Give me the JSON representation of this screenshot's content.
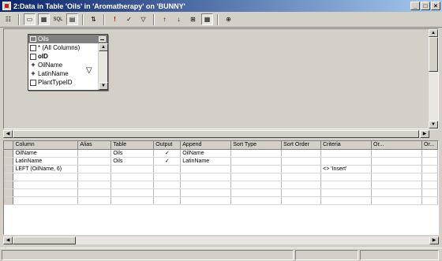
{
  "window": {
    "title": "2:Data in Table 'Oils' in 'Aromatherapy' on 'BUNNY'",
    "minimize": "_",
    "maximize": "□",
    "close": "×"
  },
  "toolbar": {
    "buttons": [
      {
        "name": "properties",
        "glyph": "☷"
      },
      {
        "name": "diagram-pane",
        "glyph": "▭"
      },
      {
        "name": "grid-pane",
        "glyph": "▦"
      },
      {
        "name": "sql-pane",
        "glyph": "SQL"
      },
      {
        "name": "results-pane",
        "glyph": "▤"
      },
      {
        "name": "change-query-type",
        "glyph": "⇅"
      },
      {
        "name": "run",
        "glyph": "!"
      },
      {
        "name": "verify-sql",
        "glyph": "✓"
      },
      {
        "name": "remove-filter",
        "glyph": "▽"
      },
      {
        "name": "sort-ascending",
        "glyph": "↑"
      },
      {
        "name": "sort-descending",
        "glyph": "↓"
      },
      {
        "name": "group-by",
        "glyph": "⊞"
      },
      {
        "name": "add-table",
        "glyph": "▦"
      },
      {
        "name": "new-view",
        "glyph": "⊕"
      }
    ]
  },
  "diagram": {
    "table": {
      "name": "Oils",
      "columns": [
        {
          "check": "",
          "label": "* (All Columns)"
        },
        {
          "check": "",
          "label": "oID"
        },
        {
          "check": "+",
          "label": "OilName"
        },
        {
          "check": "+",
          "label": "LatinName"
        },
        {
          "check": "",
          "label": "PlantTypeID"
        }
      ]
    }
  },
  "grid": {
    "headers": [
      "Column",
      "Alias",
      "Table",
      "Output",
      "Append",
      "Sort Type",
      "Sort Order",
      "Criteria",
      "Or...",
      "Or..."
    ],
    "rows": [
      [
        "OilName",
        "",
        "Oils",
        "✓",
        "OilName",
        "",
        "",
        "",
        "",
        ""
      ],
      [
        "LatinName",
        "",
        "Oils",
        "✓",
        "LatinName",
        "",
        "",
        "",
        "",
        ""
      ],
      [
        "LEFT (OilName, 6)",
        "",
        "",
        "",
        "",
        "",
        "",
        "<> 'Insert'",
        "",
        ""
      ],
      [
        "",
        "",
        "",
        "",
        "",
        "",
        "",
        "",
        "",
        ""
      ],
      [
        "",
        "",
        "",
        "",
        "",
        "",
        "",
        "",
        "",
        ""
      ],
      [
        "",
        "",
        "",
        "",
        "",
        "",
        "",
        "",
        "",
        ""
      ],
      [
        "",
        "",
        "",
        "",
        "",
        "",
        "",
        "",
        "",
        ""
      ]
    ]
  }
}
